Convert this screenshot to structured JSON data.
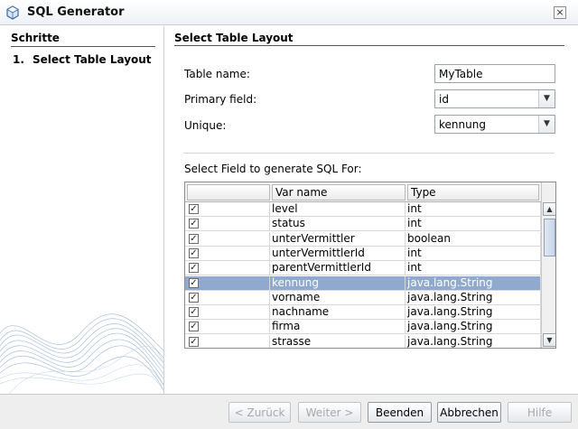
{
  "window": {
    "title": "SQL Generator",
    "close_glyph": "×"
  },
  "steps": {
    "title": "Schritte",
    "items": [
      {
        "num": "1.",
        "label": "Select Table Layout"
      }
    ]
  },
  "main": {
    "title": "Select Table Layout",
    "table_name_label": "Table name:",
    "table_name_value": "MyTable",
    "primary_field_label": "Primary field:",
    "primary_field_value": "id",
    "unique_label": "Unique:",
    "unique_value": "kennung",
    "table_caption": "Select Field to generate SQL For:"
  },
  "table": {
    "headers": [
      "",
      "Var name",
      "Type"
    ],
    "rows": [
      {
        "checked": true,
        "name": "level",
        "type": "int"
      },
      {
        "checked": true,
        "name": "status",
        "type": "int"
      },
      {
        "checked": true,
        "name": "unterVermittler",
        "type": "boolean"
      },
      {
        "checked": true,
        "name": "unterVermittlerId",
        "type": "int"
      },
      {
        "checked": true,
        "name": "parentVermittlerId",
        "type": "int"
      },
      {
        "checked": true,
        "name": "kennung",
        "type": "java.lang.String",
        "selected": true
      },
      {
        "checked": true,
        "name": "vorname",
        "type": "java.lang.String"
      },
      {
        "checked": true,
        "name": "nachname",
        "type": "java.lang.String"
      },
      {
        "checked": true,
        "name": "firma",
        "type": "java.lang.String"
      },
      {
        "checked": true,
        "name": "strasse",
        "type": "java.lang.String"
      }
    ]
  },
  "buttons": {
    "back": "< Zurück",
    "next": "Weiter >",
    "finish": "Beenden",
    "cancel": "Abbrechen",
    "help": "Hilfe"
  },
  "colors": {
    "selection": "#8fa9cf",
    "accent": "#4a7ab8"
  }
}
